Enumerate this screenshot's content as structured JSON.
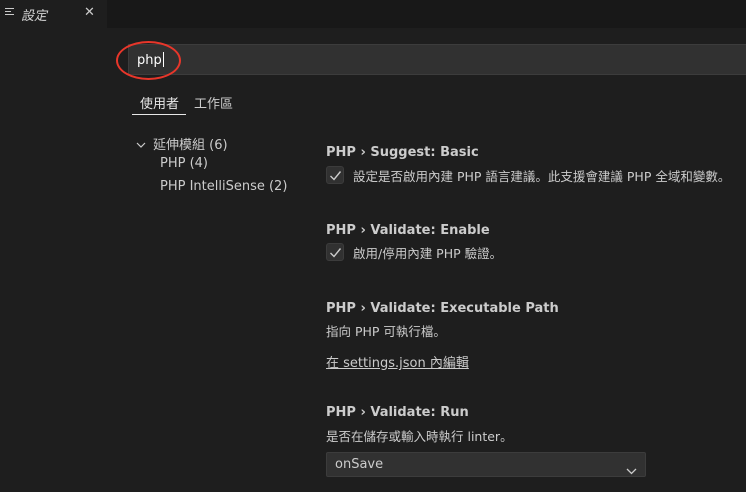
{
  "tab": {
    "icon": "settings-list-icon",
    "label": "設定",
    "close": "✕"
  },
  "search": {
    "value": "php"
  },
  "scopes": {
    "user": "使用者",
    "workspace": "工作區"
  },
  "toc": {
    "group": "延伸模組 (6)",
    "items": [
      "PHP (4)",
      "PHP IntelliSense (2)"
    ]
  },
  "settings": [
    {
      "category": "PHP › Suggest: ",
      "name": "Basic",
      "description": "設定是否啟用內建 PHP 語言建議。此支援會建議 PHP 全域和變數。",
      "checked": true
    },
    {
      "category": "PHP › Validate: ",
      "name": "Enable",
      "description": "啟用/停用內建 PHP 驗證。",
      "checked": true
    },
    {
      "category": "PHP › Validate: ",
      "name": "Executable Path",
      "description": "指向 PHP 可執行檔。",
      "link": "在 settings.json 內編輯"
    },
    {
      "category": "PHP › Validate: ",
      "name": "Run",
      "description": "是否在儲存或輸入時執行 linter。",
      "selected": "onSave"
    }
  ]
}
